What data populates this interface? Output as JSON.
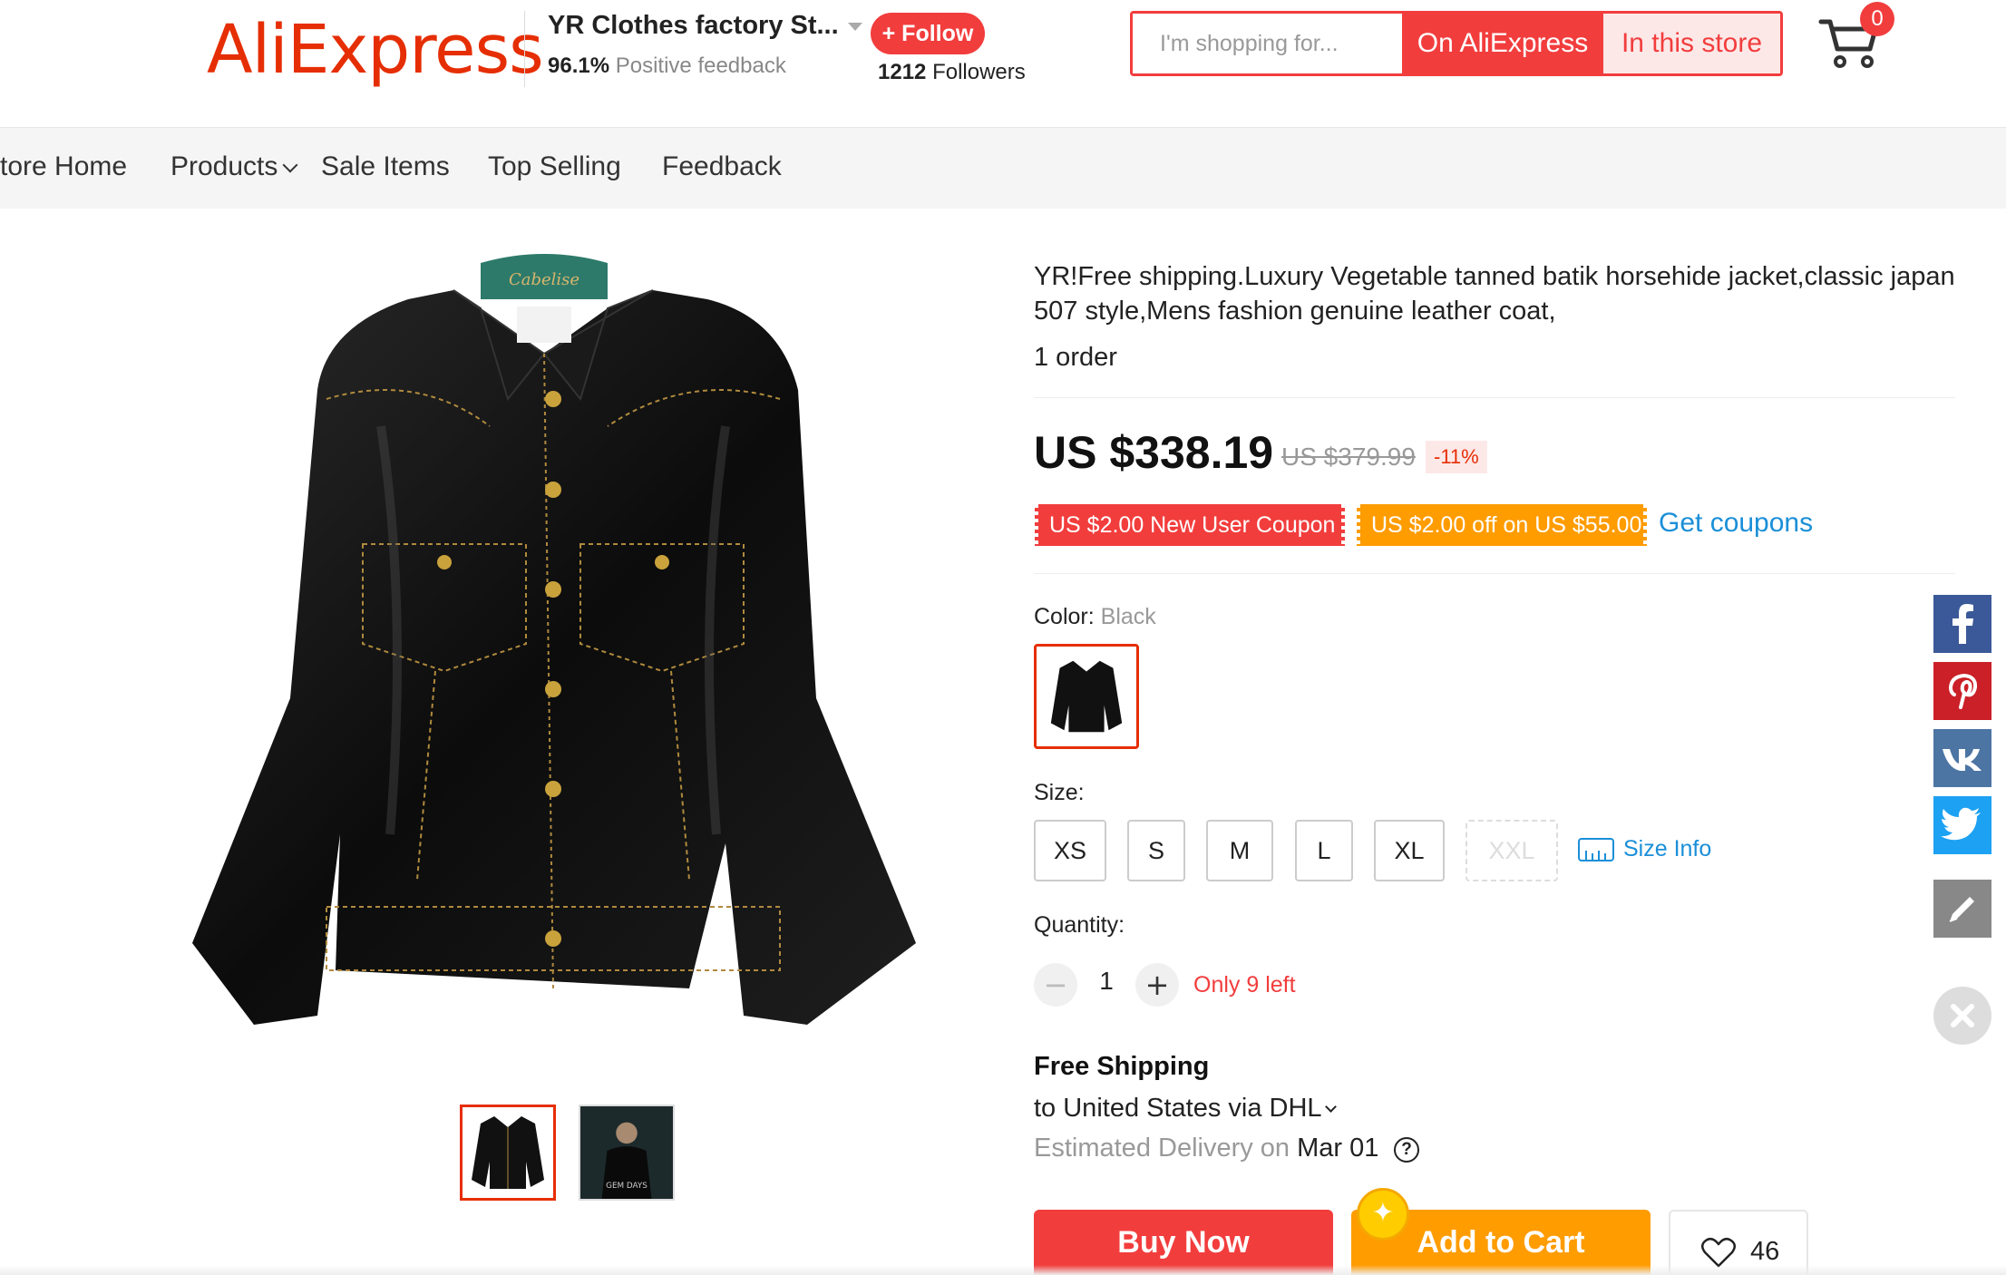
{
  "header": {
    "logo": "AliExpress",
    "store_name": "YR Clothes factory St...",
    "feedback_pct": "96.1%",
    "feedback_label": "Positive feedback",
    "follow_label": "+ Follow",
    "followers_count": "1212",
    "followers_label": "Followers",
    "search_placeholder": "I'm shopping for...",
    "search_ali_label": "On AliExpress",
    "search_store_label": "In this store",
    "cart_count": "0",
    "accent_color": "#f23d3d"
  },
  "nav": {
    "items": [
      {
        "label": "tore Home"
      },
      {
        "label": "Products"
      },
      {
        "label": "Sale Items"
      },
      {
        "label": "Top Selling"
      },
      {
        "label": "Feedback"
      }
    ]
  },
  "gallery": {
    "hanger_text": "Cabelise",
    "thumb2_caption": "GEM DAYS"
  },
  "product": {
    "title": "YR!Free shipping.Luxury Vegetable tanned batik horsehide jacket,classic japan 507 style,Mens fashion genuine leather coat,",
    "orders": "1 order",
    "price": "US $338.19",
    "old_price": "US $379.99",
    "discount": "-11%",
    "coupon_new_user": "US $2.00 New User Coupon",
    "coupon_off": "US $2.00 off on US $55.00",
    "get_coupons": "Get coupons",
    "color_label": "Color:",
    "color_value": "Black",
    "size_label": "Size:",
    "sizes": [
      "XS",
      "S",
      "M",
      "L",
      "XL",
      "XXL"
    ],
    "size_info": "Size Info",
    "quantity_label": "Quantity:",
    "quantity": "1",
    "only_left": "Only 9 left",
    "shipping_title": "Free Shipping",
    "shipping_dest": "to United States via DHL",
    "delivery_label": "Estimated Delivery on",
    "delivery_date": "Mar 01",
    "buy_now": "Buy Now",
    "add_to_cart": "Add to Cart",
    "wishlist_count": "46"
  },
  "share": {
    "icons": [
      "facebook-icon",
      "pinterest-icon",
      "vk-icon",
      "twitter-icon",
      "edit-icon",
      "close-icon"
    ],
    "facebook_color": "#3b5998",
    "pinterest_color": "#cb2027",
    "vk_color": "#4c75a3",
    "twitter_color": "#1da1f2"
  }
}
